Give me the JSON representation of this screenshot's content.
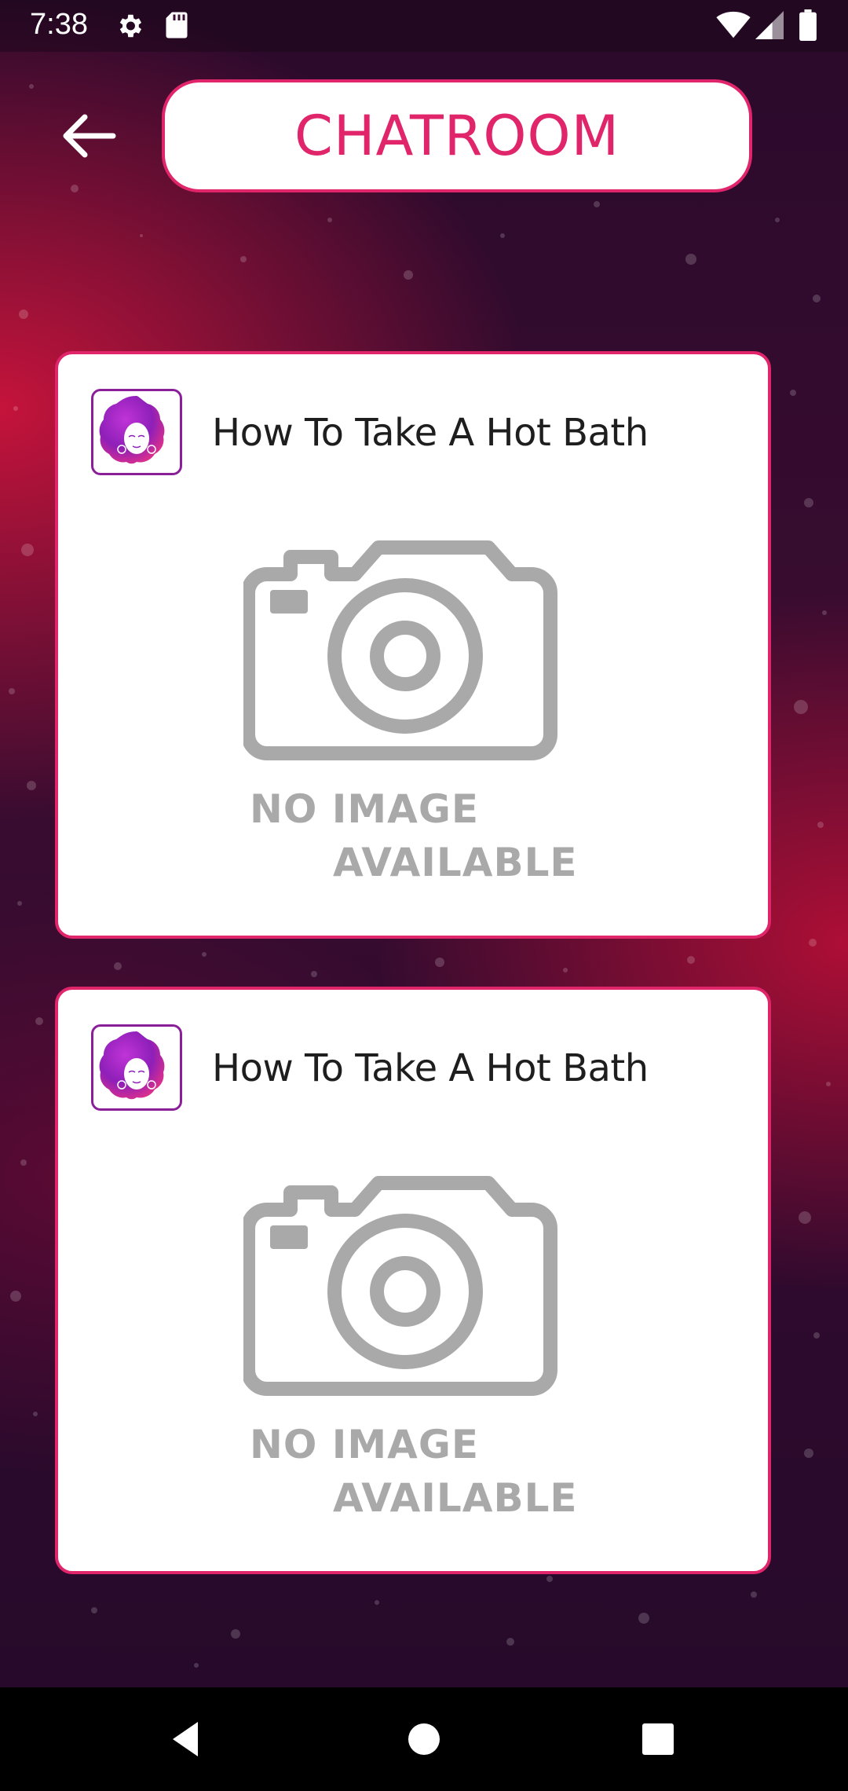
{
  "status_bar": {
    "time": "7:38",
    "icons": [
      "gear-icon",
      "sd-card-icon",
      "wifi-icon",
      "signal-icon",
      "battery-icon"
    ]
  },
  "header": {
    "back_icon": "arrow-left-icon",
    "title": "CHATROOM"
  },
  "cards": [
    {
      "title": "How To Take A Hot Bath",
      "avatar_icon": "afro-woman-avatar",
      "placeholder_line1": "NO IMAGE",
      "placeholder_line2": "AVAILABLE"
    },
    {
      "title": "How To Take A Hot Bath",
      "avatar_icon": "afro-woman-avatar",
      "placeholder_line1": "NO IMAGE",
      "placeholder_line2": "AVAILABLE"
    }
  ],
  "nav_bar": {
    "icons": [
      "nav-back-icon",
      "nav-home-icon",
      "nav-recents-icon"
    ]
  },
  "colors": {
    "accent": "#e0256b",
    "avatar_border": "#8b1f9a",
    "placeholder_gray": "#a9a9a9",
    "background_dark": "#2a0a2c",
    "background_red": "#cd143c"
  }
}
